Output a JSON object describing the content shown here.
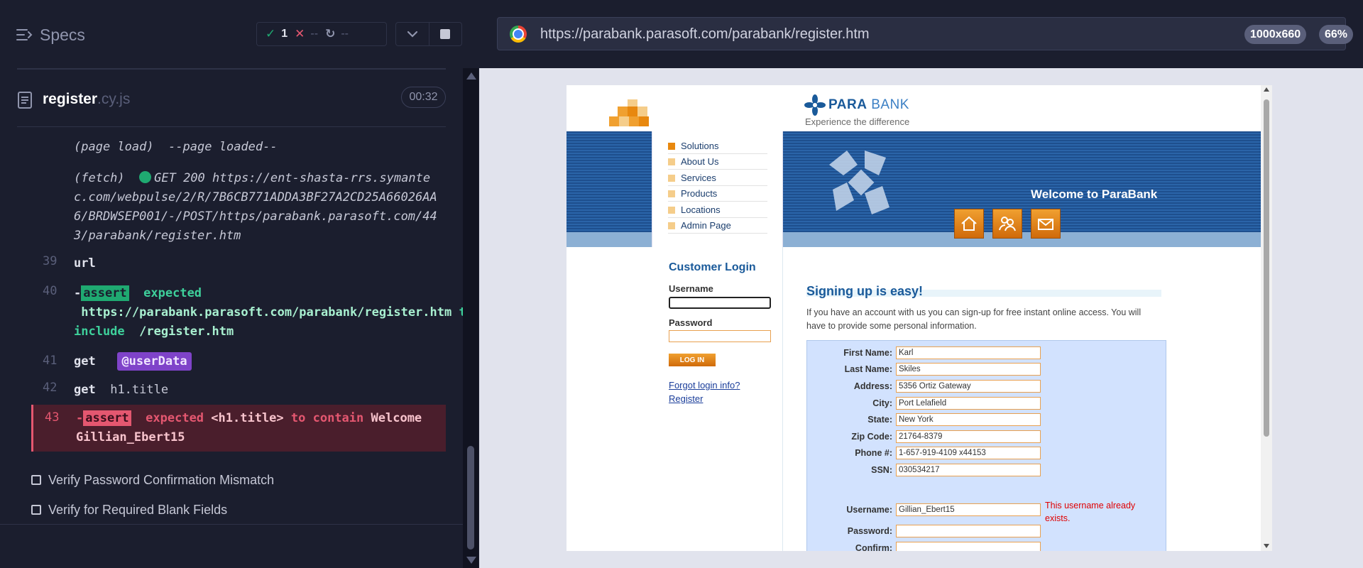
{
  "reporter": {
    "specs_label": "Specs",
    "stats": {
      "passed": "1",
      "failed": "--",
      "pending": "--"
    },
    "spec": {
      "name": "register",
      "ext": ".cy.js",
      "duration": "00:32"
    },
    "commands": {
      "page_load": {
        "event": "(page load)",
        "msg": "--page loaded--"
      },
      "fetch": {
        "event": "(fetch)",
        "msg": "GET 200 https://ent-shasta-rrs.symantec.com/webpulse/2/R/7B6CB771ADDA3BF27A2CD25A66026AA6/BRDWSEP001/-/POST/https/parabank.parasoft.com/443/parabank/register.htm"
      },
      "c39": {
        "num": "39",
        "name": "url"
      },
      "c40": {
        "num": "40",
        "dash": "-",
        "tag": "assert",
        "w1": "expected",
        "v1": "https://parabank.parasoft.com/parabank/register.htm",
        "w2": "to include",
        "v2": "/register.htm"
      },
      "c41": {
        "num": "41",
        "name": "get",
        "arg": "@userData"
      },
      "c42": {
        "num": "42",
        "name": "get",
        "arg": "h1.title"
      },
      "c43": {
        "num": "43",
        "dash": "-",
        "tag": "assert",
        "w1": "expected",
        "v1": "<h1.title>",
        "w2": "to contain",
        "v2": "Welcome Gillian_Ebert15"
      }
    },
    "tests": [
      "Verify Password Confirmation Mismatch",
      "Verify for Required Blank Fields"
    ]
  },
  "browser": {
    "url": "https://parabank.parasoft.com/parabank/register.htm",
    "viewport": "1000x660",
    "zoom": "66%"
  },
  "aut": {
    "brand_bold": "PARA",
    "brand_light": " BANK",
    "tagline": "Experience the difference",
    "menu": [
      "Solutions",
      "About Us",
      "Services",
      "Products",
      "Locations",
      "Admin Page"
    ],
    "welcome": "Welcome to ParaBank",
    "login": {
      "title": "Customer Login",
      "username_label": "Username",
      "password_label": "Password",
      "button": "LOG IN",
      "forgot": "Forgot login info?",
      "register": "Register"
    },
    "main": {
      "title": "Signing up is easy!",
      "intro": "If you have an account with us you can sign-up for free instant online access. You will have to provide some personal information.",
      "fields": [
        {
          "label": "First Name:",
          "value": "Karl"
        },
        {
          "label": "Last Name:",
          "value": "Skiles"
        },
        {
          "label": "Address:",
          "value": "5356 Ortiz Gateway"
        },
        {
          "label": "City:",
          "value": "Port Lelafield"
        },
        {
          "label": "State:",
          "value": "New York"
        },
        {
          "label": "Zip Code:",
          "value": "21764-8379"
        },
        {
          "label": "Phone #:",
          "value": "1-657-919-4109 x44153"
        },
        {
          "label": "SSN:",
          "value": "030534217"
        }
      ],
      "account_fields": [
        {
          "label": "Username:",
          "value": "Gillian_Ebert15",
          "error": "This username already exists."
        },
        {
          "label": "Password:",
          "value": ""
        },
        {
          "label": "Confirm:",
          "value": ""
        }
      ]
    }
  }
}
